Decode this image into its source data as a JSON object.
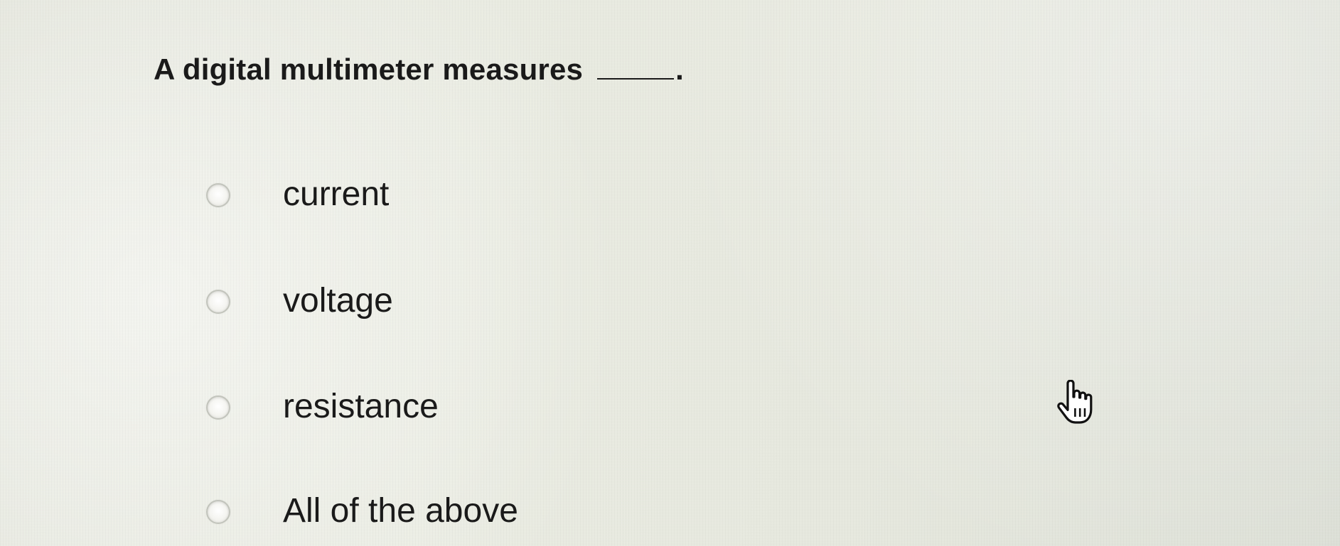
{
  "question": {
    "text": "A digital multimeter measures",
    "blank_end": "."
  },
  "options": [
    {
      "label": "current",
      "selected": false
    },
    {
      "label": "voltage",
      "selected": false
    },
    {
      "label": "resistance",
      "selected": false
    },
    {
      "label": "All of the above",
      "selected": false
    }
  ],
  "cursor": {
    "icon": "pointing-hand-cursor-icon"
  }
}
